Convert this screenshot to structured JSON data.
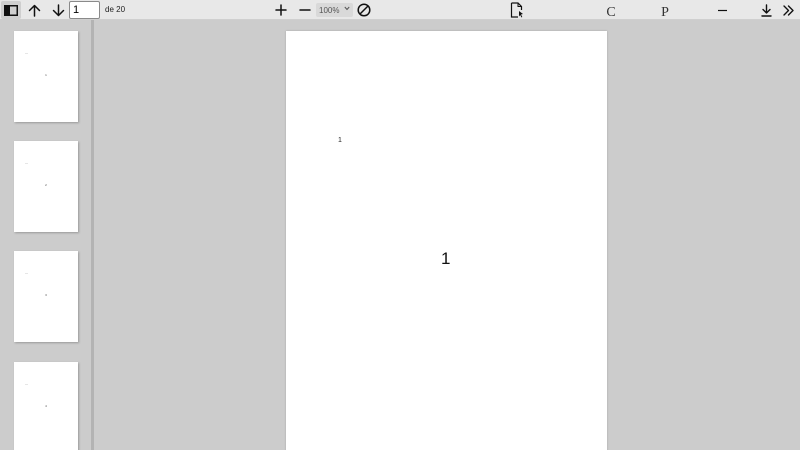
{
  "toolbar": {
    "page_input_value": "1",
    "page_count_label": "de 20",
    "zoom_value": "100%",
    "letter_c": "C",
    "letter_p": "P"
  },
  "icons": {
    "sidebar_toggle": "sidebar-toggle-icon",
    "prev_page": "arrow-up-icon",
    "next_page": "arrow-down-icon",
    "zoom_in": "plus-icon",
    "zoom_out": "minus-icon",
    "zoom_dropdown": "chevron-down-icon",
    "rotate": "no-symbol-icon",
    "document": "document-cursor-icon",
    "minimize": "minus-icon",
    "download": "download-icon",
    "more": "double-chevron-right-icon"
  },
  "colors": {
    "toolbar_bg": "#e8e8e8",
    "viewer_bg": "#cccccc",
    "page_bg": "#ffffff"
  },
  "thumbnails": [
    {
      "label": "1"
    },
    {
      "label": "2"
    },
    {
      "label": "3"
    },
    {
      "label": "4"
    }
  ],
  "page": {
    "header_number": "1",
    "center_number": "1"
  }
}
